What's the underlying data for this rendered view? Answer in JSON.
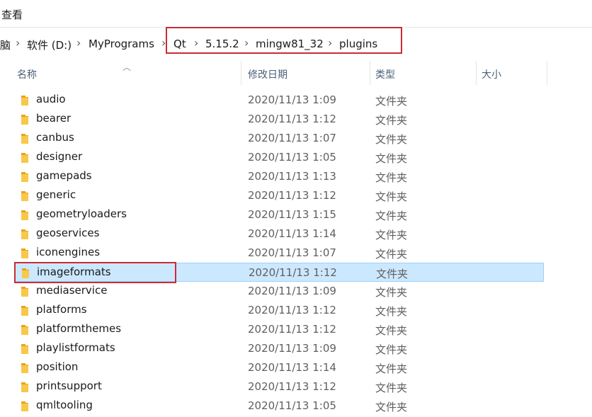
{
  "menu": {
    "view": "查看"
  },
  "breadcrumb": {
    "items": [
      "脑",
      "软件 (D:)",
      "MyPrograms",
      "Qt",
      "5.15.2",
      "mingw81_32",
      "plugins"
    ]
  },
  "columns": {
    "name": "名称",
    "modified": "修改日期",
    "type": "类型",
    "size": "大小"
  },
  "files": [
    {
      "name": "audio",
      "modified": "2020/11/13 1:09",
      "type": "文件夹"
    },
    {
      "name": "bearer",
      "modified": "2020/11/13 1:12",
      "type": "文件夹"
    },
    {
      "name": "canbus",
      "modified": "2020/11/13 1:07",
      "type": "文件夹"
    },
    {
      "name": "designer",
      "modified": "2020/11/13 1:05",
      "type": "文件夹"
    },
    {
      "name": "gamepads",
      "modified": "2020/11/13 1:13",
      "type": "文件夹"
    },
    {
      "name": "generic",
      "modified": "2020/11/13 1:12",
      "type": "文件夹"
    },
    {
      "name": "geometryloaders",
      "modified": "2020/11/13 1:15",
      "type": "文件夹"
    },
    {
      "name": "geoservices",
      "modified": "2020/11/13 1:14",
      "type": "文件夹"
    },
    {
      "name": "iconengines",
      "modified": "2020/11/13 1:07",
      "type": "文件夹"
    },
    {
      "name": "imageformats",
      "modified": "2020/11/13 1:12",
      "type": "文件夹"
    },
    {
      "name": "mediaservice",
      "modified": "2020/11/13 1:09",
      "type": "文件夹"
    },
    {
      "name": "platforms",
      "modified": "2020/11/13 1:12",
      "type": "文件夹"
    },
    {
      "name": "platformthemes",
      "modified": "2020/11/13 1:12",
      "type": "文件夹"
    },
    {
      "name": "playlistformats",
      "modified": "2020/11/13 1:09",
      "type": "文件夹"
    },
    {
      "name": "position",
      "modified": "2020/11/13 1:14",
      "type": "文件夹"
    },
    {
      "name": "printsupport",
      "modified": "2020/11/13 1:12",
      "type": "文件夹"
    },
    {
      "name": "qmltooling",
      "modified": "2020/11/13 1:05",
      "type": "文件夹"
    }
  ],
  "selected_file": "imageformats",
  "colors": {
    "selection_bg": "#cce8ff",
    "selection_border": "#99d1ff",
    "annotation_red": "#cc2b36",
    "folder_yellow": "#f8c84a"
  }
}
